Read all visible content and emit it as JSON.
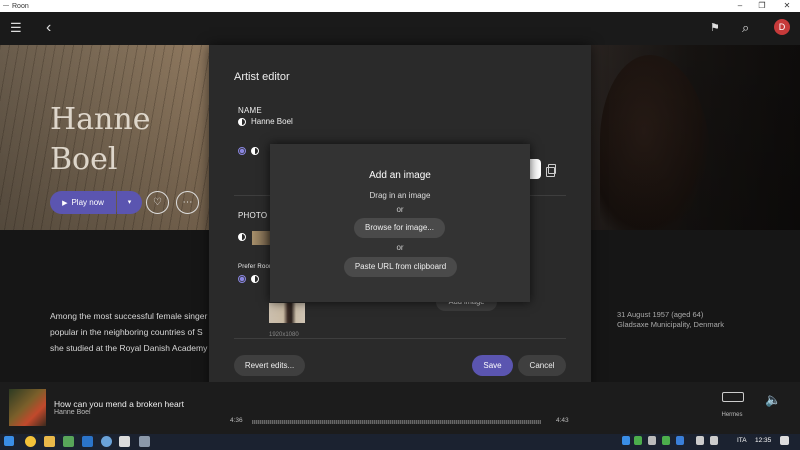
{
  "window": {
    "title": "Roon",
    "minimize": "–",
    "maximize": "❐",
    "close": "✕"
  },
  "topbar": {
    "menu_icon": "☰",
    "back_icon": "‹",
    "bookmark_icon": "⚑",
    "search_icon": "⌕",
    "avatar_letter": "D"
  },
  "hero": {
    "name_line1": "Hanne",
    "name_line2": "Boel",
    "play_label": "Play now",
    "play_icon": "▶",
    "caret_icon": "▾",
    "heart_icon": "♡",
    "more_icon": "⋯"
  },
  "bio": {
    "line1": "Among the most successful female singer",
    "line2": "popular in the neighboring countries of S",
    "line3": "she studied at the Royal Danish Academy"
  },
  "meta": {
    "born": "31 August 1957 (aged 64)",
    "place": "Gladsaxe Municipality, Denmark"
  },
  "editor": {
    "title": "Artist editor",
    "name_section": "NAME",
    "name_value": "Hanne Boel",
    "photo_section": "PHOTO",
    "prefer_label": "Prefer Roon",
    "photo_dims": "1920x1080",
    "add_image_button": "Add image",
    "revert_button": "Revert edits...",
    "save_button": "Save",
    "cancel_button": "Cancel"
  },
  "add_image_dialog": {
    "title": "Add an image",
    "drag_text": "Drag in an image",
    "or1": "or",
    "browse_button": "Browse for image...",
    "or2": "or",
    "paste_button": "Paste URL from clipboard"
  },
  "player": {
    "track_title": "How can you mend a broken heart",
    "track_artist": "Hanne Boel",
    "elapsed": "4:36",
    "total": "4:43",
    "zone_name": "Hermes",
    "volume_icon": "🔈"
  },
  "taskbar": {
    "lang": "ITA",
    "clock": "12:35"
  },
  "colors": {
    "accent": "#5b55b0",
    "avatar": "#c63a3a",
    "modal": "#2a2a2a"
  }
}
